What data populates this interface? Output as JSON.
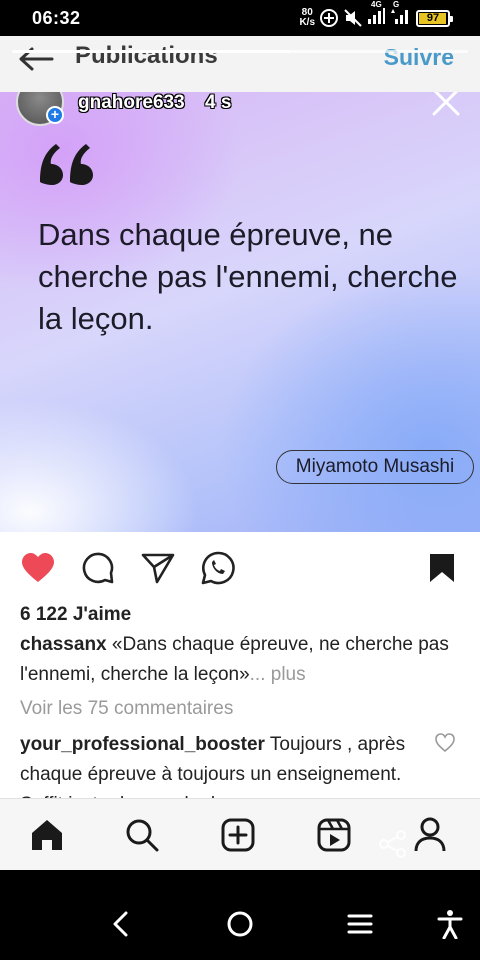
{
  "status_bar": {
    "time": "06:32",
    "net_speed_value": "80",
    "net_speed_unit": "K/s",
    "signal_1_label": "4G",
    "signal_2_label": "G",
    "battery_level": "97",
    "battery_color": "#e7c323"
  },
  "header": {
    "title": "Publications",
    "follow_label": "Suivre"
  },
  "post": {
    "username": "gnahore633",
    "time": "4 s",
    "quote": "Dans chaque épreuve, ne cherche pas l'ennemi, cherche la leçon.",
    "author": "Miyamoto Musashi",
    "likes": "6 122 J'aime",
    "caption_user": "chassanx",
    "caption_text": "«Dans chaque épreuve, ne cherche pas l'ennemi, cherche la leçon»",
    "caption_more": "... plus",
    "comments_link": "Voir les 75 commentaires",
    "comment_user": "your_professional_booster",
    "comment_text": "Toujours , après chaque épreuve à toujours un enseignement. Suffit juste de prendre le"
  },
  "icons": {
    "like": "heart-icon",
    "comment": "comment-icon",
    "share": "paper-plane-icon",
    "whatsapp": "whatsapp-icon",
    "save": "bookmark-icon",
    "like_color": "#ed4956"
  },
  "tab_bar": [
    "home-icon",
    "search-icon",
    "add-post-icon",
    "reels-icon",
    "profile-icon"
  ],
  "system_nav": [
    "back-icon",
    "home-circle-icon",
    "recents-icon",
    "accessibility-icon"
  ]
}
